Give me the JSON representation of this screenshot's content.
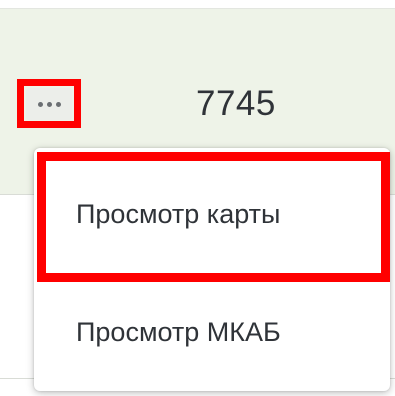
{
  "row": {
    "number": "7745"
  },
  "menu": {
    "items": [
      {
        "label": "Просмотр карты"
      },
      {
        "label": "Просмотр МКАБ"
      }
    ]
  },
  "colors": {
    "highlight": "#ff0000",
    "row_background": "#eef3e8",
    "text": "#2f3338"
  },
  "icons": {
    "more": "more-horizontal-icon"
  }
}
